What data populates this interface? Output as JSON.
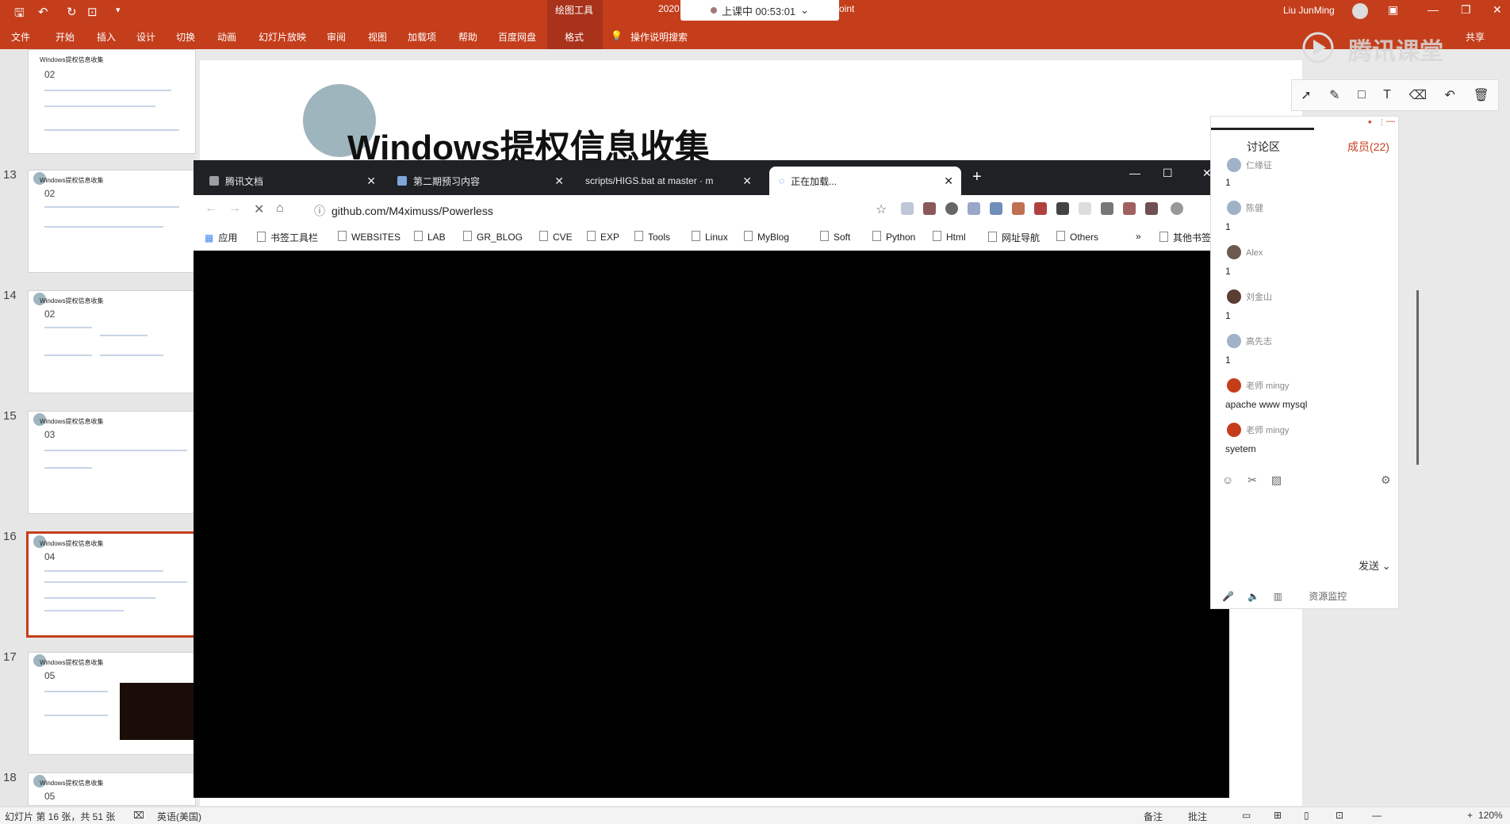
{
  "ppt": {
    "ribbon_tabs": [
      "文件",
      "开始",
      "插入",
      "设计",
      "切换",
      "动画",
      "幻灯片放映",
      "审阅",
      "视图",
      "加载项",
      "帮助",
      "百度网盘",
      "格式",
      "操作说明搜索"
    ],
    "context_tool": "绘图工具",
    "year_fragment": "2020",
    "title_suffix": "oint",
    "user": "Liu JunMing",
    "share": "共享",
    "watermark": "腾讯课堂",
    "timer": "上课中 00:53:01"
  },
  "thumbs": [
    {
      "num": "13",
      "title": "Windows提权信息收集",
      "section": "02"
    },
    {
      "num": "14",
      "title": "Windows提权信息收集",
      "section": "02"
    },
    {
      "num": "15",
      "title": "Windows提权信息收集",
      "section": "03"
    },
    {
      "num": "16",
      "title": "Windows提权信息收集",
      "section": "04"
    },
    {
      "num": "17",
      "title": "Windows提权信息收集",
      "section": "05"
    },
    {
      "num": "18",
      "title": "Windows提权信息收集",
      "section": "05"
    }
  ],
  "top_thumb": {
    "title": "Windows提权信息收集",
    "section": "02"
  },
  "slide": {
    "title": "Windows提权信息收集"
  },
  "chrome": {
    "tabs": [
      {
        "label": "腾讯文档"
      },
      {
        "label": "第二期预习内容"
      },
      {
        "label": "scripts/HIGS.bat at master · m"
      },
      {
        "label": "正在加载..."
      }
    ],
    "url": "github.com/M4ximuss/Powerless",
    "bookmarks": [
      "应用",
      "书签工具栏",
      "WEBSITES",
      "LAB",
      "GR_BLOG",
      "CVE",
      "EXP",
      "Tools",
      "Linux",
      "MyBlog",
      "Soft",
      "Python",
      "Html",
      "网址导航",
      "Others",
      "»",
      "其他书签"
    ]
  },
  "chat": {
    "tab_discussion": "讨论区",
    "tab_members": "成员(22)",
    "messages": [
      {
        "name": "仁缘征",
        "text": "1"
      },
      {
        "name": "陈健",
        "text": "1"
      },
      {
        "name": "Alex",
        "text": "1"
      },
      {
        "name": "刘金山",
        "text": "1"
      },
      {
        "name": "高先志",
        "text": "1"
      },
      {
        "name": "老师 mingy",
        "text": "apache www mysql"
      },
      {
        "name": "老师 mingy",
        "text": "syetem"
      }
    ],
    "send": "发送",
    "resource_monitor": "资源监控"
  },
  "status": {
    "slide_info": "幻灯片 第 16 张，共 51 张",
    "language": "英语(美国)",
    "notes": "备注",
    "comments": "批注",
    "zoom": "120%"
  },
  "colors": {
    "accent": "#c43e1c",
    "chrome_dark": "#202124"
  }
}
